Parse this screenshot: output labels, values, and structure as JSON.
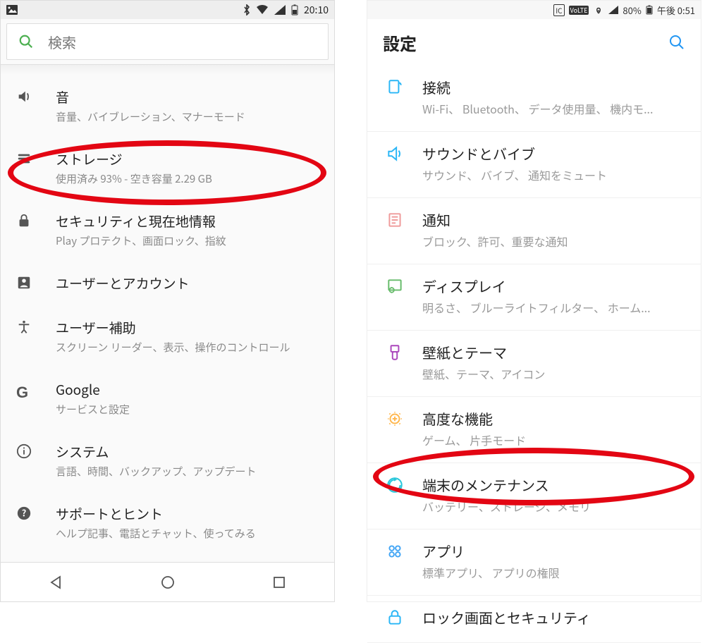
{
  "left": {
    "statusbar": {
      "icons": [
        "picture",
        "bluetooth",
        "wifi",
        "signal",
        "battery"
      ],
      "time": "20:10"
    },
    "search": {
      "placeholder": "検索"
    },
    "items": [
      {
        "icon": "sound",
        "title": "音",
        "sub": "音量、バイブレーション、マナーモード"
      },
      {
        "icon": "storage",
        "title": "ストレージ",
        "sub": "使用済み 93% - 空き容量 2.29 GB"
      },
      {
        "icon": "lock",
        "title": "セキュリティと現在地情報",
        "sub": "Play プロテクト、画面ロック、指紋"
      },
      {
        "icon": "user",
        "title": "ユーザーとアカウント",
        "sub": ""
      },
      {
        "icon": "access",
        "title": "ユーザー補助",
        "sub": "スクリーン リーダー、表示、操作のコントロール"
      },
      {
        "icon": "google",
        "title": "Google",
        "sub": "サービスと設定"
      },
      {
        "icon": "info",
        "title": "システム",
        "sub": "言語、時間、バックアップ、アップデート"
      },
      {
        "icon": "help",
        "title": "サポートとヒント",
        "sub": "ヘルプ記事、電話とチャット、使ってみる"
      }
    ],
    "nav": {
      "back": "◁",
      "home": "○",
      "recents": "□"
    },
    "highlight_index": 1
  },
  "right": {
    "statusbar": {
      "icons": [
        "ic",
        "volte",
        "wifi",
        "signal"
      ],
      "battery_pct": "80%",
      "time": "午後 0:51"
    },
    "header": {
      "title": "設定"
    },
    "items": [
      {
        "color": "#29b6f6",
        "kind": "conn",
        "title": "接続",
        "sub": "Wi-Fi、 Bluetooth、 データ使用量、 機内モ..."
      },
      {
        "color": "#29b6f6",
        "kind": "sound",
        "title": "サウンドとバイブ",
        "sub": "サウンド、 バイブ、 通知をミュート"
      },
      {
        "color": "#ef9a9a",
        "kind": "notif",
        "title": "通知",
        "sub": "ブロック、許可、重要な通知"
      },
      {
        "color": "#66bb6a",
        "kind": "display",
        "title": "ディスプレイ",
        "sub": "明るさ、 ブルーライトフィルター、 ホーム..."
      },
      {
        "color": "#ab47bc",
        "kind": "wall",
        "title": "壁紙とテーマ",
        "sub": "壁紙、テーマ、アイコン"
      },
      {
        "color": "#ffb74d",
        "kind": "adv",
        "title": "高度な機能",
        "sub": "ゲーム、 片手モード"
      },
      {
        "color": "#26c6da",
        "kind": "maint",
        "title": "端末のメンテナンス",
        "sub": "バッテリー、ストレージ、メモリ"
      },
      {
        "color": "#42a5f5",
        "kind": "apps",
        "title": "アプリ",
        "sub": "標準アプリ、 アプリの権限"
      },
      {
        "color": "#29b6f6",
        "kind": "lock",
        "title": "ロック画面とセキュリティ",
        "sub": ""
      }
    ],
    "highlight_index": 6
  }
}
